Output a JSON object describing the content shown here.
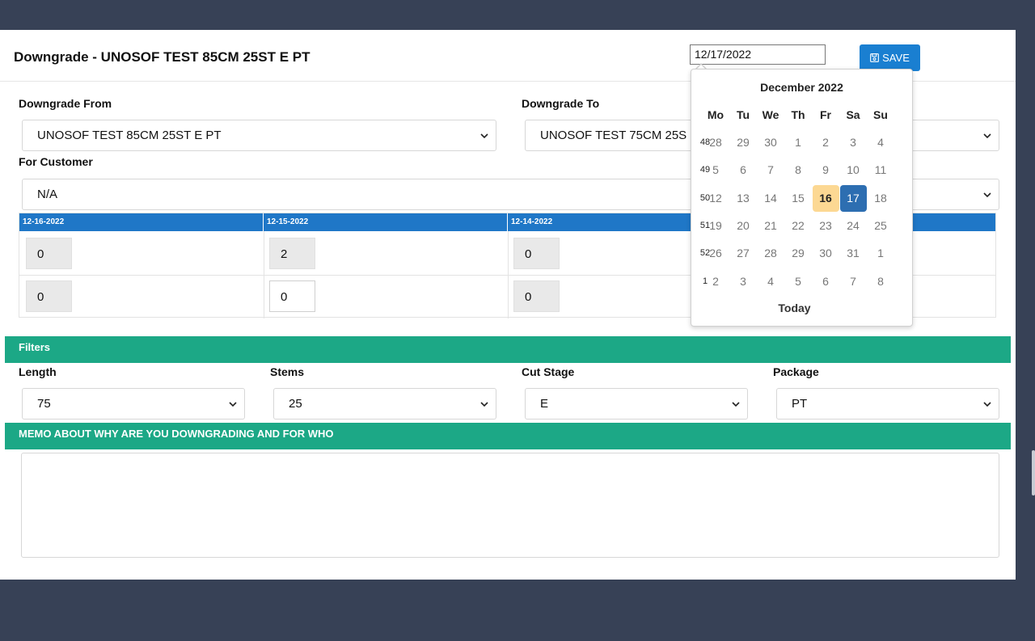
{
  "header": {
    "title": "Downgrade - UNOSOF TEST 85CM 25ST E PT",
    "date_value": "12/17/2022",
    "save_label": "SAVE"
  },
  "form": {
    "downgrade_from_label": "Downgrade From",
    "downgrade_from_value": "UNOSOF TEST 85CM 25ST E PT",
    "downgrade_to_label": "Downgrade To",
    "downgrade_to_value": "UNOSOF TEST 75CM 25S",
    "for_customer_label": "For Customer",
    "for_customer_value": "N/A"
  },
  "inventory": {
    "dates": [
      "12-16-2022",
      "12-15-2022",
      "12-14-2022"
    ],
    "rows": [
      [
        "0",
        "2",
        "0"
      ],
      [
        "0",
        "0",
        "0"
      ]
    ]
  },
  "filters": {
    "section_label": "Filters",
    "length_label": "Length",
    "length_value": "75",
    "stems_label": "Stems",
    "stems_value": "25",
    "cut_stage_label": "Cut Stage",
    "cut_stage_value": "E",
    "package_label": "Package",
    "package_value": "PT"
  },
  "memo": {
    "section_label": "MEMO ABOUT WHY ARE YOU DOWNGRADING AND FOR WHO",
    "value": ""
  },
  "calendar": {
    "title": "December 2022",
    "weekdays": [
      "Mo",
      "Tu",
      "We",
      "Th",
      "Fr",
      "Sa",
      "Su"
    ],
    "weeks": [
      {
        "week": "48",
        "days": [
          "28",
          "29",
          "30",
          "1",
          "2",
          "3",
          "4"
        ]
      },
      {
        "week": "49",
        "days": [
          "5",
          "6",
          "7",
          "8",
          "9",
          "10",
          "11"
        ]
      },
      {
        "week": "50",
        "days": [
          "12",
          "13",
          "14",
          "15",
          "16",
          "17",
          "18"
        ]
      },
      {
        "week": "51",
        "days": [
          "19",
          "20",
          "21",
          "22",
          "23",
          "24",
          "25"
        ]
      },
      {
        "week": "52",
        "days": [
          "26",
          "27",
          "28",
          "29",
          "30",
          "31",
          "1"
        ]
      },
      {
        "week": "1",
        "days": [
          "2",
          "3",
          "4",
          "5",
          "6",
          "7",
          "8"
        ]
      }
    ],
    "today_day": "16",
    "selected_day": "17",
    "today_button": "Today"
  },
  "colors": {
    "accent": "#1a7fd1",
    "table_header": "#1f77c7",
    "section_band": "#1ca886",
    "today_highlight": "#fcd893",
    "selected_day": "#2d6eb1",
    "backdrop": "#374156"
  }
}
